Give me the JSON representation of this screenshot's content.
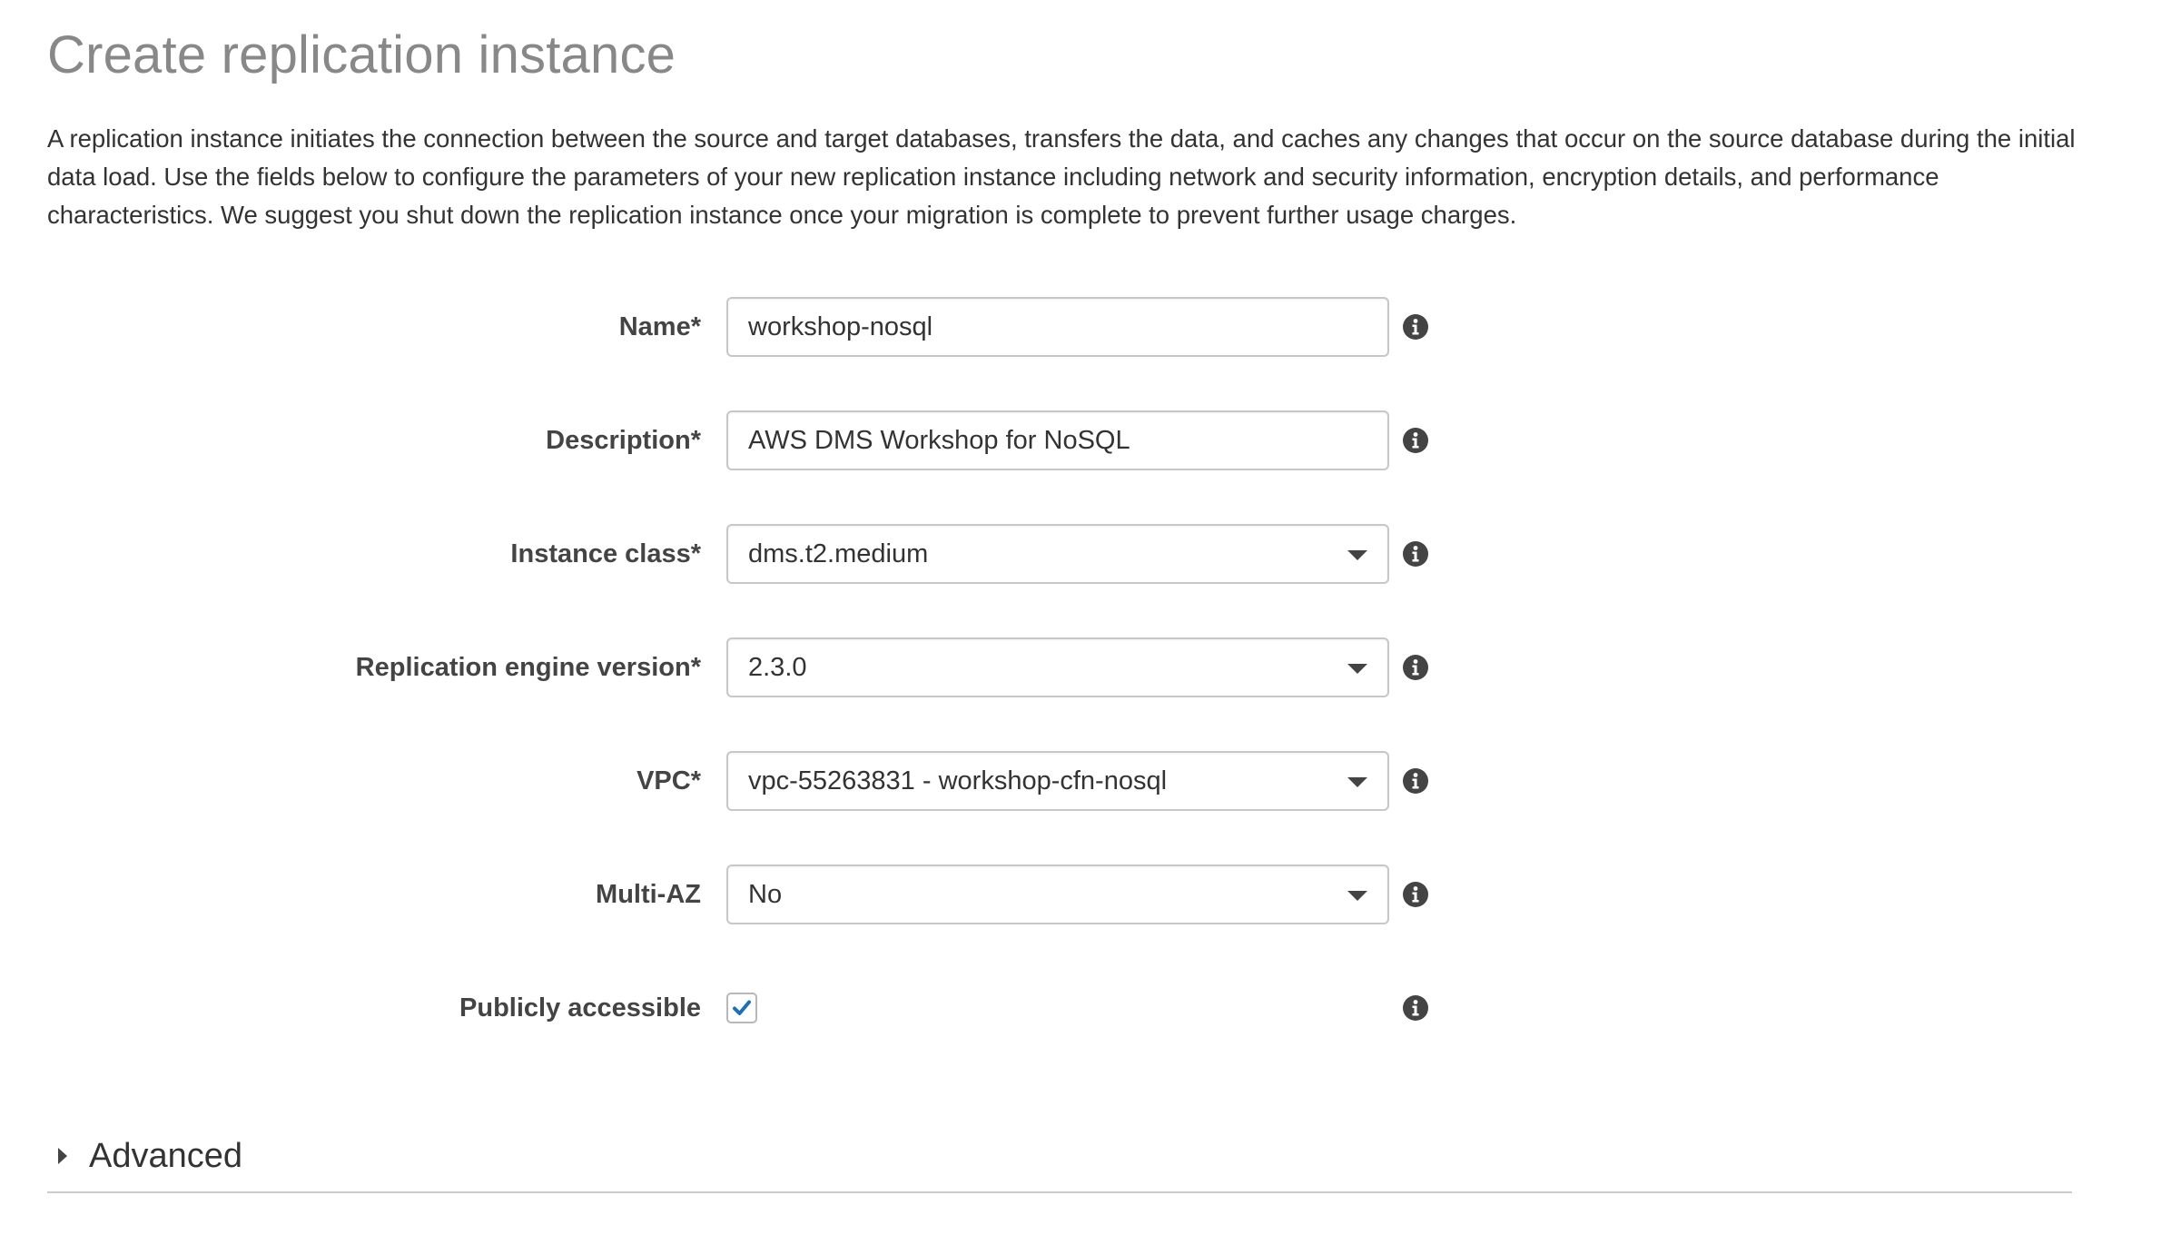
{
  "page": {
    "title": "Create replication instance",
    "description": "A replication instance initiates the connection between the source and target databases, transfers the data, and caches any changes that occur on the source database during the initial data load. Use the fields below to configure the parameters of your new replication instance including network and security information, encryption details, and performance characteristics. We suggest you shut down the replication instance once your migration is complete to prevent further usage charges."
  },
  "form": {
    "name": {
      "label": "Name*",
      "value": "workshop-nosql"
    },
    "description": {
      "label": "Description*",
      "value": "AWS DMS Workshop for NoSQL"
    },
    "instance_class": {
      "label": "Instance class*",
      "selected": "dms.t2.medium"
    },
    "engine_version": {
      "label": "Replication engine version*",
      "selected": "2.3.0"
    },
    "vpc": {
      "label": "VPC*",
      "selected": "vpc-55263831 - workshop-cfn-nosql"
    },
    "multi_az": {
      "label": "Multi-AZ",
      "selected": "No"
    },
    "publicly_accessible": {
      "label": "Publicly accessible",
      "checked": true
    }
  },
  "advanced": {
    "label": "Advanced"
  },
  "icons": {
    "info": "info-icon",
    "dropdown": "chevron-down-icon",
    "checkmark": "checkmark-icon",
    "expand": "caret-right-icon"
  },
  "colors": {
    "title": "#888888",
    "label": "#444444",
    "text": "#333333",
    "border": "#c7c7c7",
    "check": "#1f6fb8"
  }
}
